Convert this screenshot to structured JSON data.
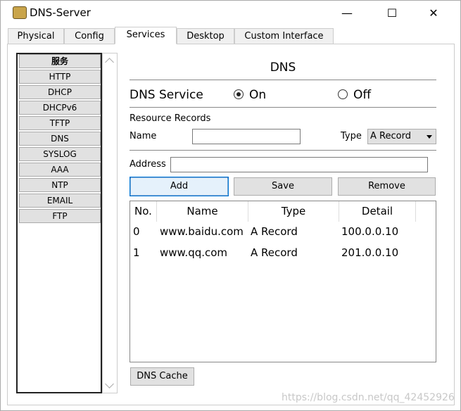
{
  "window": {
    "title": "DNS-Server",
    "minimize": "—",
    "maximize": "☐",
    "close": "✕"
  },
  "tabs": [
    {
      "label": "Physical"
    },
    {
      "label": "Config"
    },
    {
      "label": "Services"
    },
    {
      "label": "Desktop"
    },
    {
      "label": "Custom Interface"
    }
  ],
  "sidebar": {
    "items": [
      {
        "label": "服务"
      },
      {
        "label": "HTTP"
      },
      {
        "label": "DHCP"
      },
      {
        "label": "DHCPv6"
      },
      {
        "label": "TFTP"
      },
      {
        "label": "DNS"
      },
      {
        "label": "SYSLOG"
      },
      {
        "label": "AAA"
      },
      {
        "label": "NTP"
      },
      {
        "label": "EMAIL"
      },
      {
        "label": "FTP"
      }
    ]
  },
  "main": {
    "heading": "DNS",
    "service_label": "DNS Service",
    "on_label": "On",
    "off_label": "Off",
    "service_on": true,
    "resource_records": "Resource Records",
    "name_label": "Name",
    "name_value": "",
    "type_label": "Type",
    "type_value": "A Record",
    "address_label": "Address",
    "address_value": "",
    "add": "Add",
    "save": "Save",
    "remove": "Remove",
    "table": {
      "headers": [
        "No.",
        "Name",
        "Type",
        "Detail"
      ],
      "rows": [
        [
          "0",
          "www.baidu.com",
          "A Record",
          "100.0.0.10"
        ],
        [
          "1",
          "www.qq.com",
          "A Record",
          "201.0.0.10"
        ]
      ]
    },
    "dns_cache": "DNS Cache"
  },
  "watermark": "https://blog.csdn.net/qq_42452926"
}
